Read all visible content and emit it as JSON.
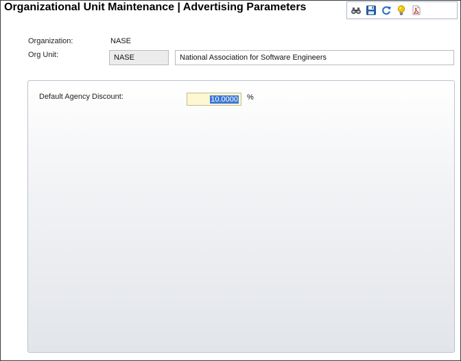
{
  "header": {
    "title": "Organizational Unit Maintenance | Advertising Parameters"
  },
  "toolbar": {
    "buttons": [
      {
        "icon": "binoculars-icon"
      },
      {
        "icon": "save-icon"
      },
      {
        "icon": "refresh-icon"
      },
      {
        "icon": "lightbulb-icon"
      },
      {
        "icon": "pdf-report-icon"
      }
    ]
  },
  "form": {
    "organization_label": "Organization:",
    "organization_value": "NASE",
    "org_unit_label": "Org Unit:",
    "org_unit_code": "NASE",
    "org_unit_name": "National Association for Software Engineers"
  },
  "panel": {
    "discount_label": "Default Agency Discount:",
    "discount_value": "10.0000",
    "discount_unit": "%"
  },
  "colors": {
    "accent": "#3a78d6",
    "input_highlight": "#fdf7d3",
    "save_icon": "#1f5fae",
    "refresh_icon": "#2f6fc4",
    "lightbulb_icon": "#f5c400",
    "pdf_icon": "#c62828"
  }
}
